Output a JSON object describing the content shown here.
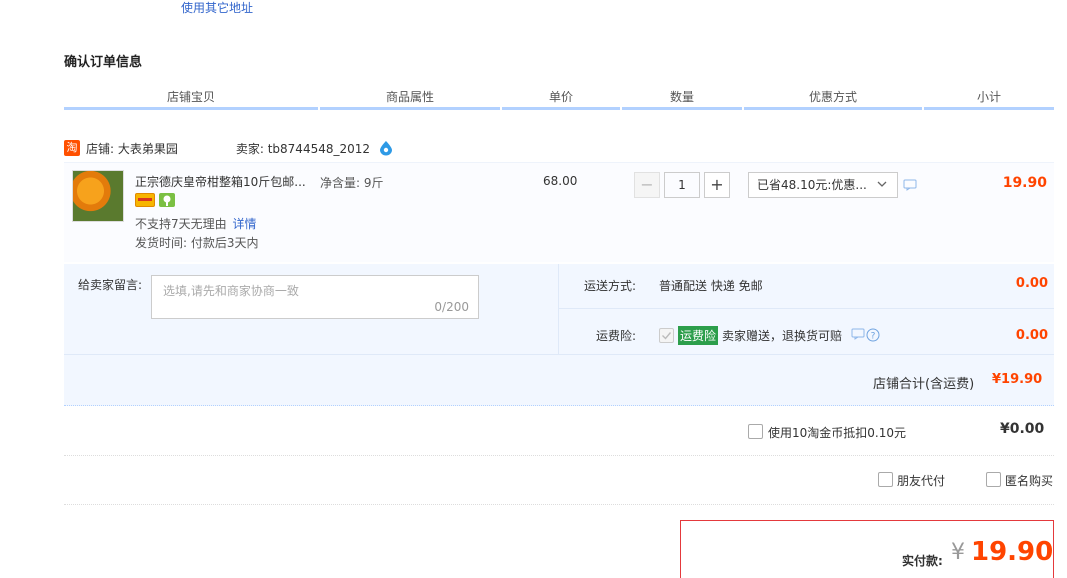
{
  "address": {
    "other_link": "使用其它地址"
  },
  "section_title": "确认订单信息",
  "columns": [
    "店铺宝贝",
    "商品属性",
    "单价",
    "数量",
    "优惠方式",
    "小计"
  ],
  "shop": {
    "logo_text": "淘",
    "name": "店铺: 大表弟果园",
    "seller": "卖家: tb8744548_2012"
  },
  "item": {
    "title": "正宗德庆皇帝柑整箱10斤包邮...",
    "attribute": "净含量: 9斤",
    "no_return": "不支持7天无理由",
    "detail_link": "详情",
    "ship_time": "发货时间: 付款后3天内",
    "unit_price": "68.00",
    "quantity": "1",
    "minus": "−",
    "plus": "+",
    "promo": "已省48.10元:优惠...",
    "subtotal": "19.90"
  },
  "memo": {
    "label": "给卖家留言:",
    "placeholder": "选填,请先和商家协商一致",
    "counter": "0/200"
  },
  "shipping": {
    "label": "运送方式:",
    "value": "普通配送 快递 免邮",
    "fee": "0.00"
  },
  "insurance": {
    "label": "运费险:",
    "badge": "运费险",
    "text": "卖家赠送，退换货可赔",
    "fee": "0.00"
  },
  "shop_total": {
    "label": "店铺合计(含运费)",
    "value": "¥19.90"
  },
  "coins": {
    "label": "使用10淘金币抵扣0.10元",
    "value": "¥0.00"
  },
  "options": {
    "friend_pay": "朋友代付",
    "anonymous": "匿名购买"
  },
  "payment": {
    "label": "实付款:",
    "currency": "¥",
    "amount": "19.90"
  },
  "colors": {
    "accent": "#ff4400",
    "link": "#3366cc",
    "header_border": "#b2d1ff",
    "panel": "#f2f7ff"
  }
}
